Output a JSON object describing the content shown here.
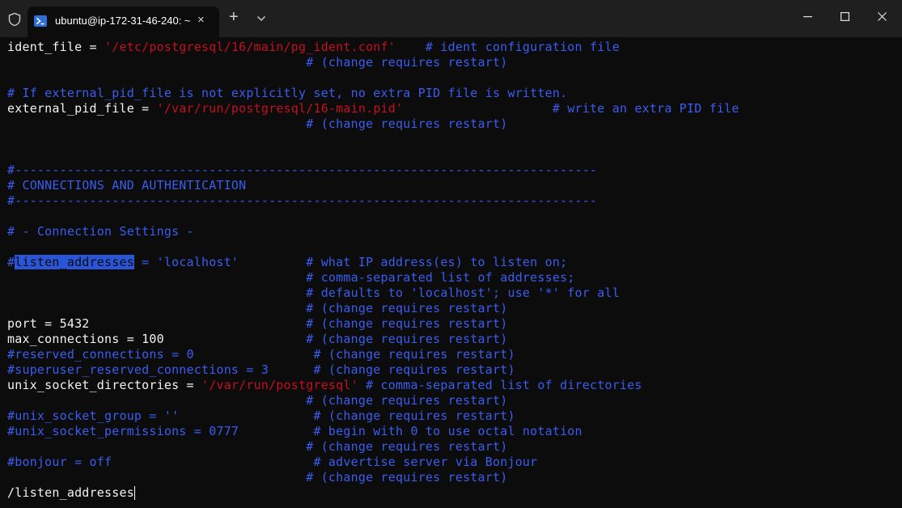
{
  "window": {
    "tab_title": "ubuntu@ip-172-31-46-240: ~",
    "tab_close": "×",
    "new_tab": "+",
    "tab_icon": "powershell-icon"
  },
  "terminal": {
    "l1a": "ident_file = ",
    "l1b": "'/etc/postgresql/16/main/pg_ident.conf'",
    "l1c": "    # ident configuration file",
    "l2": "                                        # (change requires restart)",
    "l4": "# If external_pid_file is not explicitly set, no extra PID file is written.",
    "l5a": "external_pid_file = ",
    "l5b": "'/var/run/postgresql/16-main.pid'",
    "l5c": "                    # write an extra PID file",
    "l6": "                                        # (change requires restart)",
    "l9": "#------------------------------------------------------------------------------",
    "l10": "# CONNECTIONS AND AUTHENTICATION",
    "l11": "#------------------------------------------------------------------------------",
    "l13": "# - Connection Settings -",
    "l15a": "#",
    "l15b": "listen_addresses",
    "l15c": " = 'localhost'         # what IP address(es) to listen on;",
    "l16": "                                        # comma-separated list of addresses;",
    "l17": "                                        # defaults to 'localhost'; use '*' for all",
    "l18": "                                        # (change requires restart)",
    "l19a": "port = 5432",
    "l19b": "                             # (change requires restart)",
    "l20a": "max_connections = 100",
    "l20b": "                   # (change requires restart)",
    "l21": "#reserved_connections = 0                # (change requires restart)",
    "l22": "#superuser_reserved_connections = 3      # (change requires restart)",
    "l23a": "unix_socket_directories = ",
    "l23b": "'/var/run/postgresql'",
    "l23c": " # comma-separated list of directories",
    "l24": "                                        # (change requires restart)",
    "l25": "#unix_socket_group = ''                  # (change requires restart)",
    "l26": "#unix_socket_permissions = 0777          # begin with 0 to use octal notation",
    "l27": "                                        # (change requires restart)",
    "l28": "#bonjour = off                           # advertise server via Bonjour",
    "l29": "                                        # (change requires restart)",
    "search": "/listen_addresses"
  },
  "colors": {
    "background": "#0c0c0c",
    "text": "#f2f2f2",
    "string": "#c50f1f",
    "comment": "#3a5df0",
    "highlight": "#2a55d8"
  }
}
